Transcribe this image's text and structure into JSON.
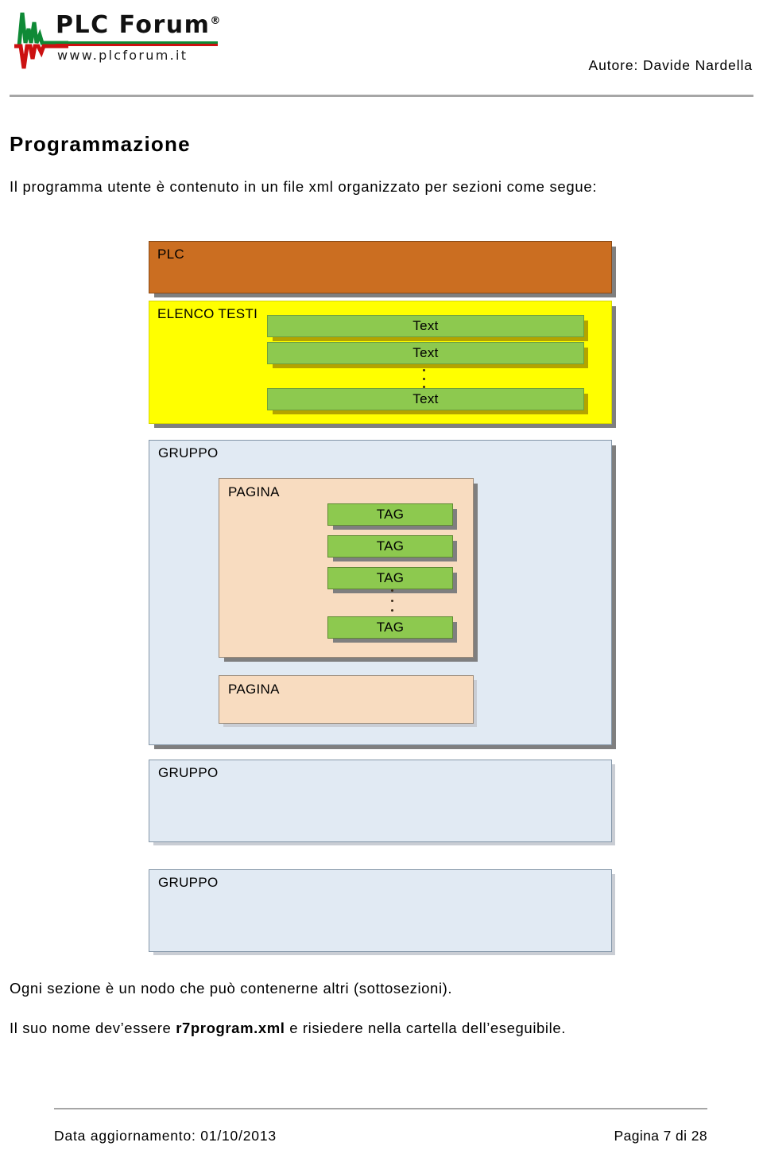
{
  "header": {
    "logo": {
      "brand": "PLC Forum",
      "registered_mark": "®",
      "url": "www.plcforum.it",
      "wave_green": "#0f8a36",
      "wave_red": "#cc1111"
    },
    "author": "Autore: Davide Nardella"
  },
  "content": {
    "title": "Programmazione",
    "intro": "Il programma utente è contenuto in un file xml organizzato per sezioni come segue:",
    "paragraph_1": "Ogni sezione è un nodo che può contenerne altri (sottosezioni).",
    "paragraph_2_before": "Il suo nome dev’essere ",
    "paragraph_2_filename": "r7program.xml",
    "paragraph_2_after": " e risiedere nella cartella dell’eseguibile."
  },
  "diagram": {
    "colors": {
      "plc": "#cb6e21",
      "elenco_testi": "#ffff00",
      "gruppo": "#e1eaf3",
      "pagina": "#f8dcc0",
      "leaf": "#8dc94f",
      "shadow_grey": "#7f7f7f",
      "shadow_olive": "#b3a400"
    },
    "plc": {
      "label": "PLC"
    },
    "elenco_testi": {
      "label": "ELENCO TESTI",
      "items": [
        {
          "label": "Text"
        },
        {
          "label": "Text"
        },
        {
          "label": "Text"
        }
      ],
      "ellipsis": "···"
    },
    "gruppo_1": {
      "label": "GRUPPO",
      "pagina_1": {
        "label": "PAGINA",
        "tags": [
          {
            "label": "TAG"
          },
          {
            "label": "TAG"
          },
          {
            "label": "TAG"
          },
          {
            "label": "TAG"
          }
        ],
        "ellipsis": "···"
      },
      "pagina_2": {
        "label": "PAGINA"
      }
    },
    "gruppo_2": {
      "label": "GRUPPO"
    },
    "gruppo_3": {
      "label": "GRUPPO"
    }
  },
  "footer": {
    "updated": "Data aggiornamento: 01/10/2013",
    "page": "Pagina 7 di 28"
  }
}
